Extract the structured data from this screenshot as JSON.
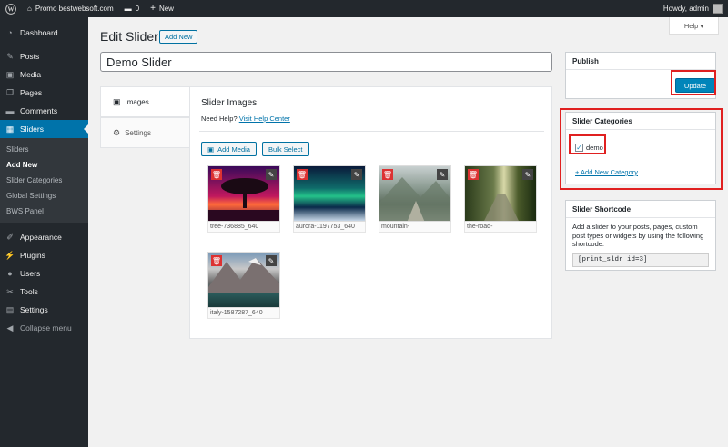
{
  "admin_bar": {
    "site_name": "Promo bestwebsoft.com",
    "comments_count": "0",
    "new_label": "New",
    "greeting": "Howdy, admin"
  },
  "sidebar": {
    "items": [
      {
        "label": "Dashboard",
        "icon": "dashboard-icon"
      },
      {
        "label": "Posts",
        "icon": "pin-icon"
      },
      {
        "label": "Media",
        "icon": "media-icon"
      },
      {
        "label": "Pages",
        "icon": "pages-icon"
      },
      {
        "label": "Comments",
        "icon": "comment-icon"
      },
      {
        "label": "Sliders",
        "icon": "sliders-icon"
      }
    ],
    "submenu": [
      "Sliders",
      "Add New",
      "Slider Categories",
      "Global Settings",
      "BWS Panel"
    ],
    "items2": [
      {
        "label": "Appearance",
        "icon": "brush-icon"
      },
      {
        "label": "Plugins",
        "icon": "plugin-icon"
      },
      {
        "label": "Users",
        "icon": "users-icon"
      },
      {
        "label": "Tools",
        "icon": "wrench-icon"
      },
      {
        "label": "Settings",
        "icon": "settings-icon"
      }
    ],
    "collapse": "Collapse menu"
  },
  "header": {
    "help": "Help ▾",
    "title": "Edit Slider",
    "add_new": "Add New",
    "slider_title_value": "Demo Slider"
  },
  "tabs": {
    "images": "Images",
    "settings": "Settings"
  },
  "images_panel": {
    "title": "Slider Images",
    "help_text": "Need Help?",
    "help_link": "Visit Help Center",
    "add_media": "Add Media",
    "bulk_select": "Bulk Select",
    "images": [
      {
        "caption": "tree-736885_640"
      },
      {
        "caption": "aurora-1197753_640"
      },
      {
        "caption": "mountain-"
      },
      {
        "caption": "the-road-"
      },
      {
        "caption": "italy-1587287_640"
      }
    ]
  },
  "publish": {
    "title": "Publish",
    "update": "Update"
  },
  "categories": {
    "title": "Slider Categories",
    "item": "demo",
    "checked": true,
    "add_new": "+ Add New Category"
  },
  "shortcode": {
    "title": "Slider Shortcode",
    "description": "Add a slider to your posts, pages, custom post types or widgets by using the following shortcode:",
    "code": "[print_sldr id=3]"
  },
  "colors": {
    "accent": "#0073aa",
    "highlight": "#e02020",
    "sidebar": "#23282d"
  }
}
